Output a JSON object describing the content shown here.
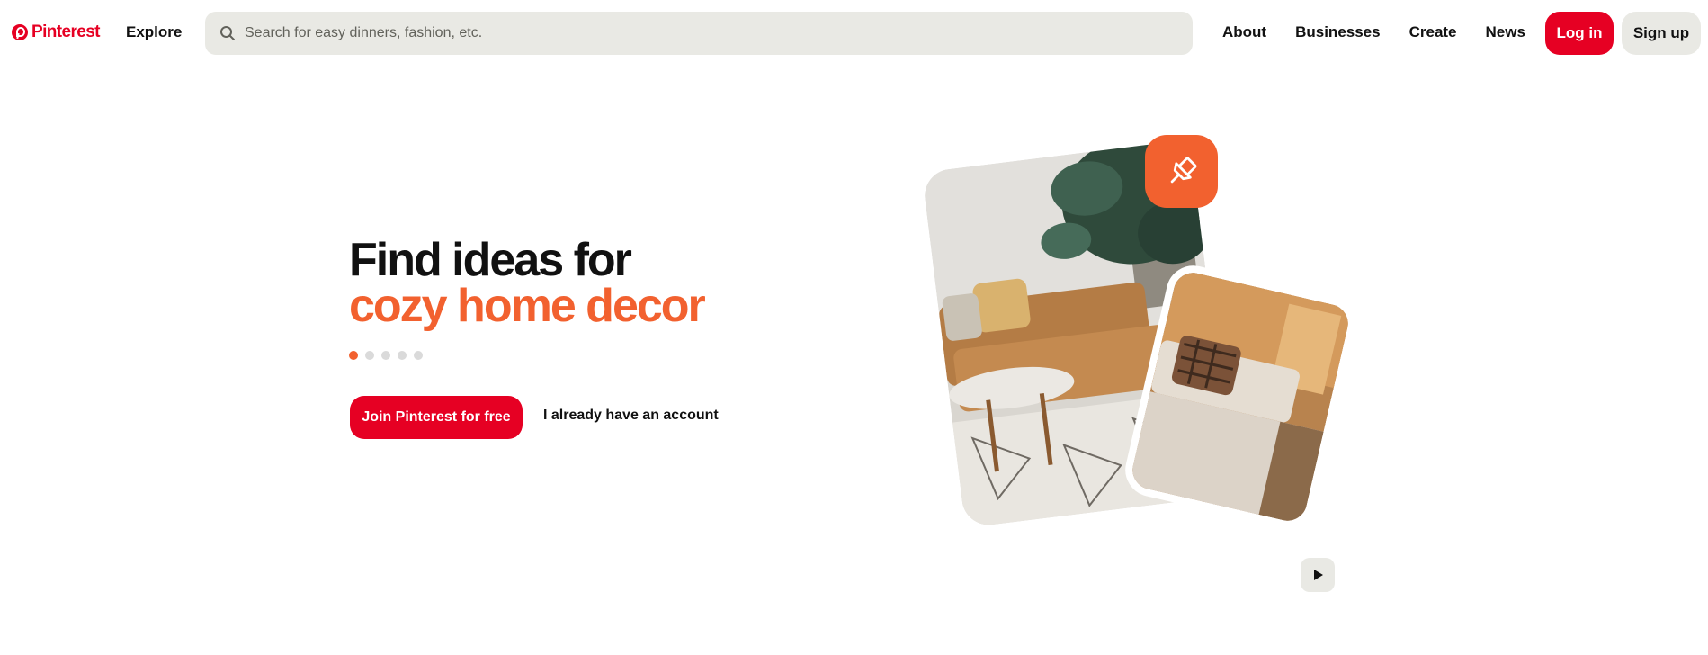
{
  "header": {
    "logo_text": "Pinterest",
    "explore_label": "Explore",
    "search": {
      "placeholder": "Search for easy dinners, fashion, etc.",
      "value": "",
      "icon": "search-icon"
    },
    "links": {
      "about": "About",
      "businesses": "Businesses",
      "create": "Create",
      "news": "News"
    },
    "login_label": "Log in",
    "signup_label": "Sign up"
  },
  "hero": {
    "title_line1": "Find ideas for",
    "title_line2": "cozy home decor",
    "carousel": {
      "count": 5,
      "active_index": 0
    },
    "join_label": "Join Pinterest for free",
    "account_label": "I already have an account"
  },
  "media": {
    "badge_icon": "pushpin-icon",
    "play_icon": "play-icon"
  },
  "colors": {
    "brand_red": "#e60023",
    "accent_orange": "#f2612f",
    "neutral_gray": "#e9e9e4"
  }
}
